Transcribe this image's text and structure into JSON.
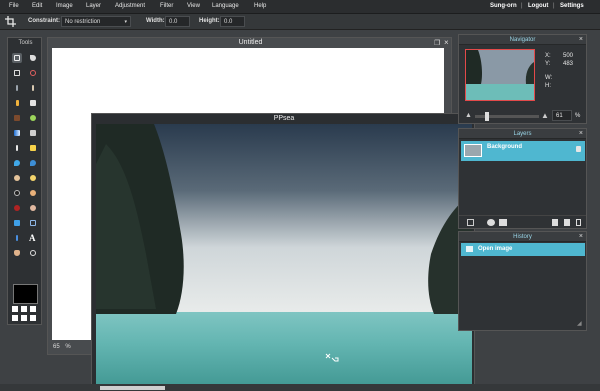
{
  "menu": {
    "items": [
      "File",
      "Edit",
      "Image",
      "Layer",
      "Adjustment",
      "Filter",
      "View",
      "Language",
      "Help"
    ],
    "right": [
      "Sung-orn",
      "Logout",
      "Settings"
    ]
  },
  "options": {
    "constraint_label": "Constraint:",
    "constraint_value": "No restriction",
    "width_label": "Width:",
    "width_value": "0.0",
    "height_label": "Height:",
    "height_value": "0.0"
  },
  "tools": {
    "title": "Tools"
  },
  "windows": {
    "untitled": {
      "title": "Untitled",
      "zoom": "65"
    },
    "ppsea": {
      "title": "PPsea"
    }
  },
  "navigator": {
    "title": "Navigator",
    "x_label": "X:",
    "x_value": "500",
    "y_label": "Y:",
    "y_value": "483",
    "w_label": "W:",
    "h_label": "H:",
    "zoom_value": "61",
    "zoom_unit": "%"
  },
  "layers": {
    "title": "Layers",
    "items": [
      {
        "name": "Background"
      }
    ]
  },
  "history": {
    "title": "History",
    "items": [
      {
        "name": "Open image"
      }
    ]
  },
  "colors": {
    "accent": "#4fb7d0"
  }
}
